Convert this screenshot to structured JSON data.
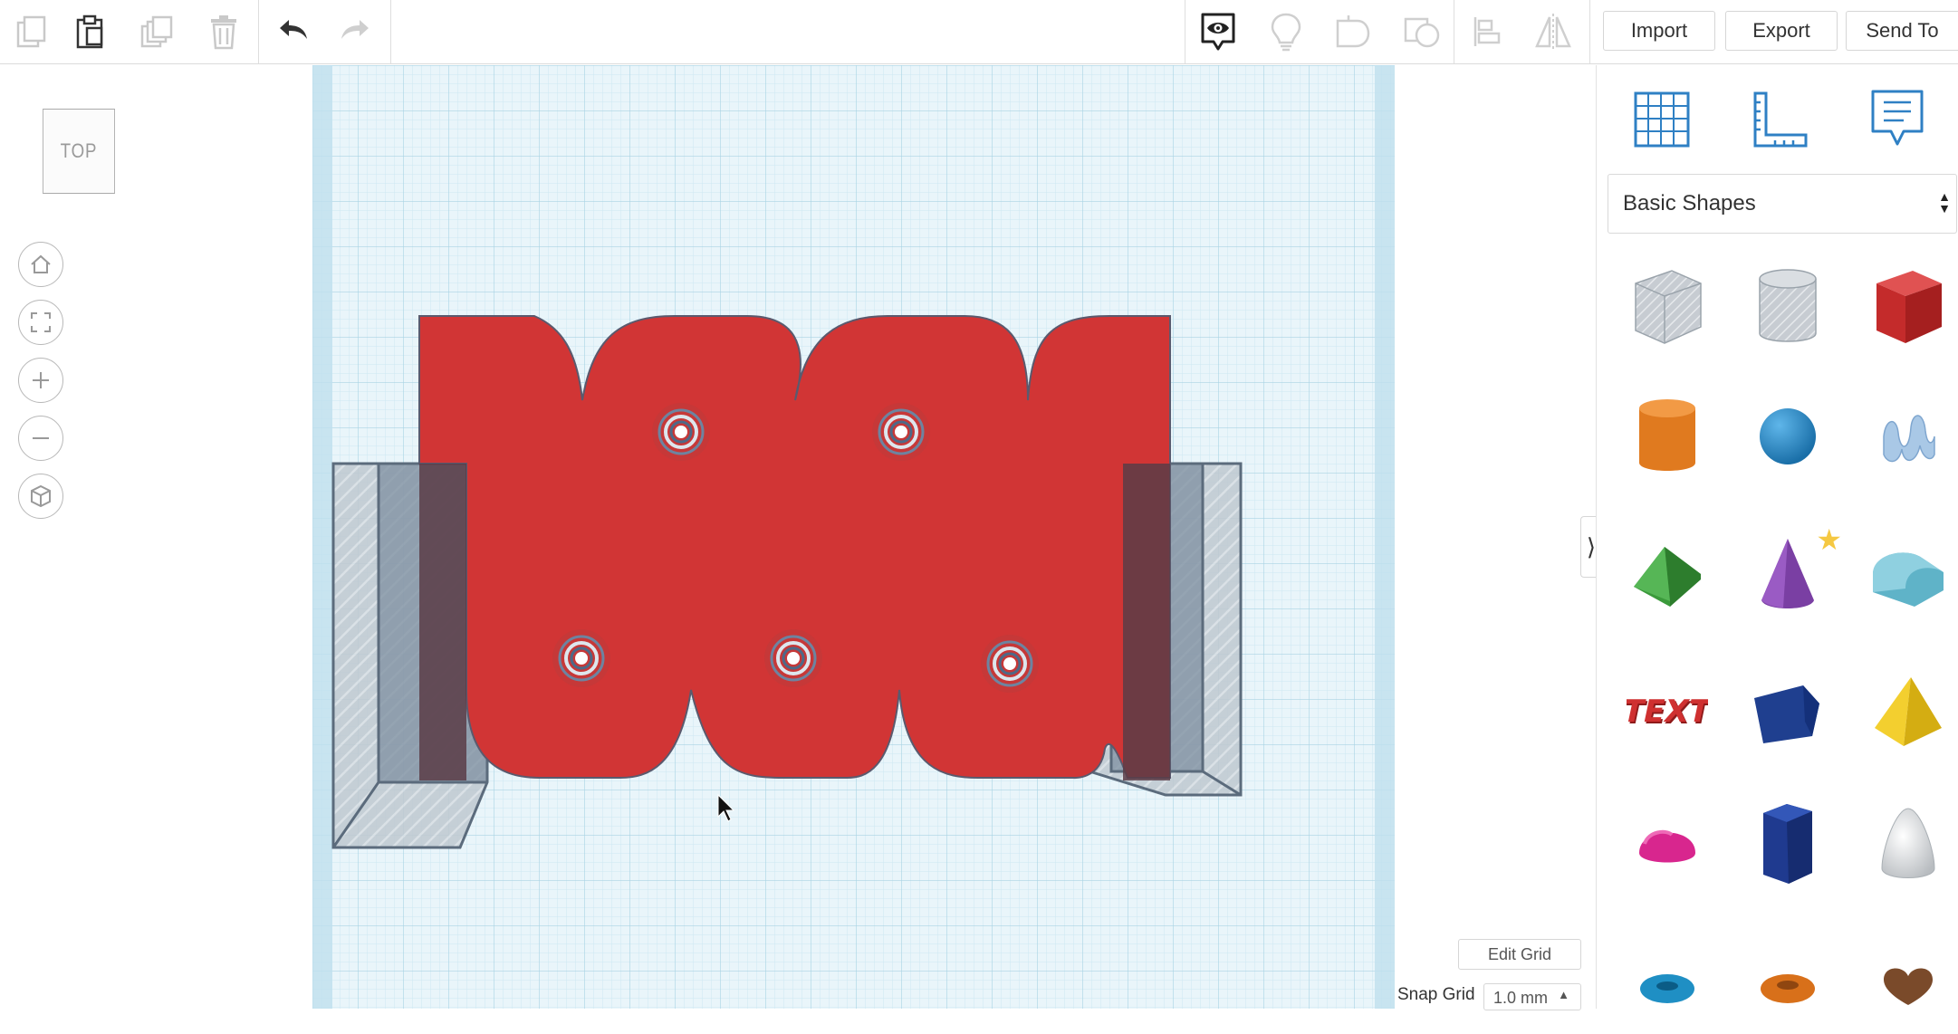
{
  "toolbar": {
    "copy_icon": "copy-icon",
    "paste_icon": "paste-icon",
    "duplicate_icon": "duplicate-icon",
    "delete_icon": "trash-icon",
    "undo_icon": "undo-icon",
    "redo_icon": "redo-icon",
    "import_label": "Import",
    "export_label": "Export",
    "send_to_label": "Send To"
  },
  "view": {
    "cube_label": "TOP"
  },
  "panel": {
    "category": "Basic Shapes",
    "shapes": [
      "Box (hole)",
      "Cylinder (hole)",
      "Box",
      "Cylinder",
      "Sphere",
      "Scribble",
      "Roof",
      "Cone",
      "Round Roof",
      "Text",
      "Wedge",
      "Pyramid",
      "Half Sphere",
      "Polygon",
      "Paraboloid",
      "Torus",
      "Tube",
      "Heart"
    ]
  },
  "grid": {
    "edit_label": "Edit Grid",
    "snap_label": "Snap Grid",
    "snap_value": "1.0 mm"
  },
  "colors": {
    "red_shape": "#d13535",
    "grid_bg": "#e6f4fa",
    "grid_line": "#b6dbea",
    "accent_blue": "#2f80c4"
  }
}
